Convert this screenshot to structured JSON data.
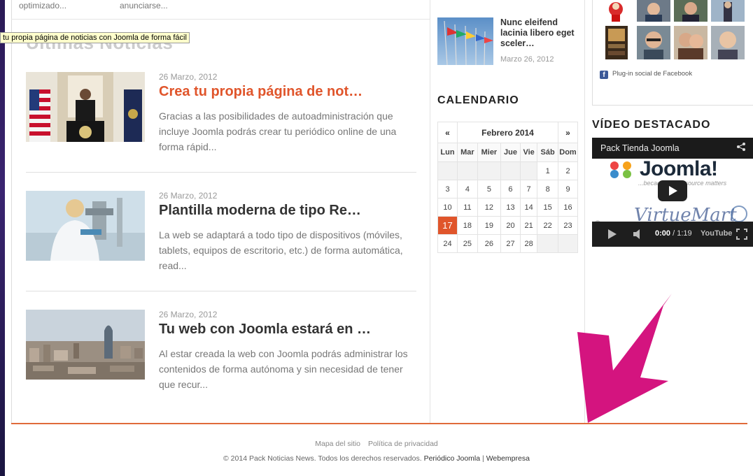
{
  "top_snippets": [
    "optimizado...",
    "anunciarse..."
  ],
  "section": {
    "title": "Últimas Noticias"
  },
  "tooltip": "tu propia página de noticias con Joomla de forma fácil",
  "articles": [
    {
      "date": "26 Marzo, 2012",
      "title": "Crea tu propia página de not…",
      "excerpt": "Gracias a las posibilidades de autoadministración que incluye Joomla podrás crear tu periódico online de una forma rápid..."
    },
    {
      "date": "26 Marzo, 2012",
      "title": "Plantilla moderna de tipo Re…",
      "excerpt": "La web se adaptará a todo tipo de dispositivos (móviles, tablets, equipos de escritorio, etc.) de forma automática, read..."
    },
    {
      "date": "26 Marzo, 2012",
      "title": "Tu web con Joomla estará en …",
      "excerpt": "Al estar creada la web con Joomla podrás administrar los contenidos de forma autónoma y sin necesidad de tener que recur..."
    }
  ],
  "side_news": {
    "title": "Nunc eleifend lacinia libero eget sceler…",
    "date": "Marzo 26, 2012"
  },
  "calendar": {
    "title": "CALENDARIO",
    "month": "Febrero 2014",
    "prev": "«",
    "next": "»",
    "weekdays": [
      "Lun",
      "Mar",
      "Mier",
      "Jue",
      "Vie",
      "Sáb",
      "Dom"
    ],
    "weeks": [
      [
        "",
        "",
        "",
        "",
        "",
        "1",
        "2"
      ],
      [
        "3",
        "4",
        "5",
        "6",
        "7",
        "8",
        "9"
      ],
      [
        "10",
        "11",
        "12",
        "13",
        "14",
        "15",
        "16"
      ],
      [
        "17",
        "18",
        "19",
        "20",
        "21",
        "22",
        "23"
      ],
      [
        "24",
        "25",
        "26",
        "27",
        "28",
        "",
        ""
      ]
    ],
    "today": "17"
  },
  "facebook": {
    "plugin_label": "Plug-in social de Facebook"
  },
  "video": {
    "section_title": "VÍDEO DESTACADO",
    "title": "Pack Tienda Joomla",
    "logo": "Joomla!",
    "logo_sub": "...because open source matters",
    "time_current": "0:00",
    "time_total": "/ 1:19",
    "brand": "YouTube"
  },
  "footer": {
    "links": [
      "Mapa del sitio",
      "Política de privacidad"
    ],
    "copyright": "© 2014 Pack Noticias News. Todos los derechos reservados.",
    "link1": "Periódico Joomla",
    "separator": "|",
    "link2": "Webempresa"
  },
  "colors": {
    "accent": "#e0552b",
    "arrow": "#d4147f"
  }
}
